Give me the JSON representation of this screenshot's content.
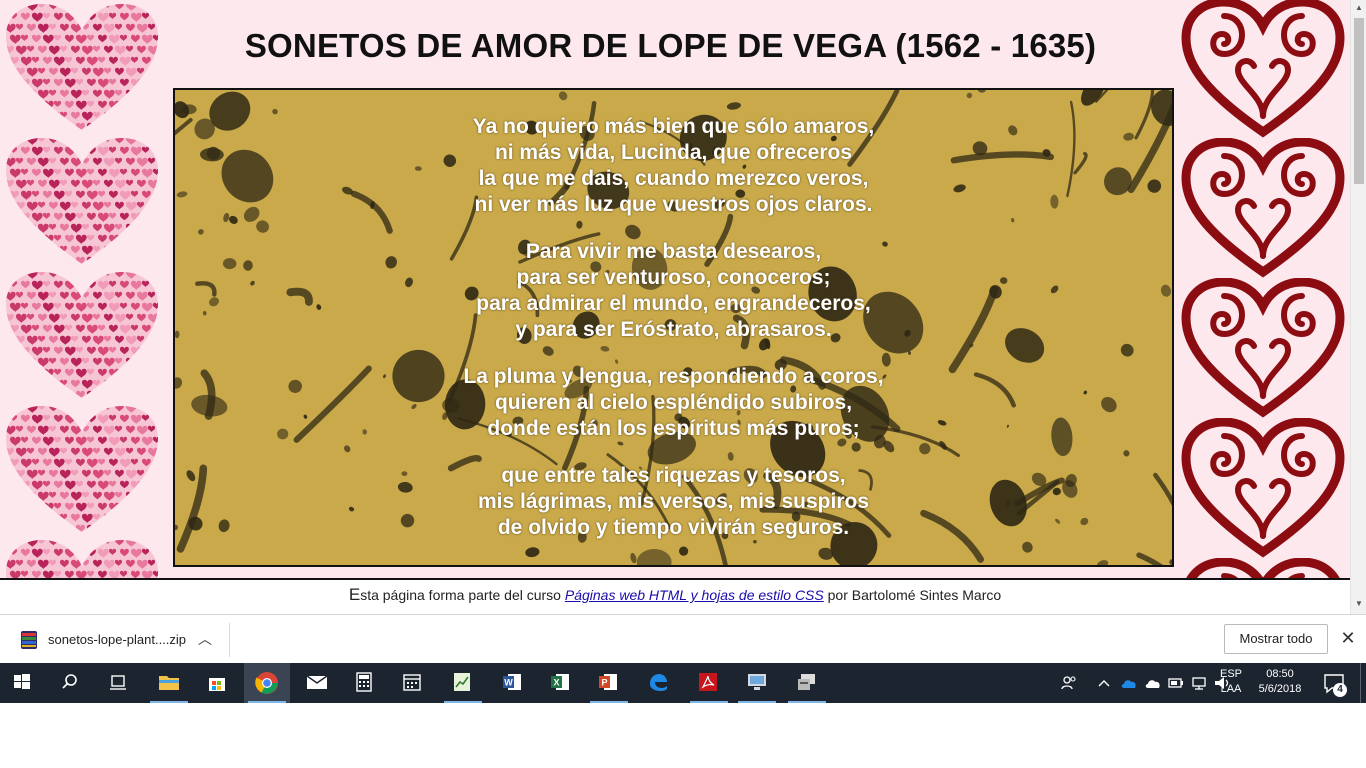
{
  "page": {
    "title": "SONETOS DE AMOR DE LOPE DE VEGA (1562 - 1635)",
    "poem": [
      [
        "Ya no quiero más bien que sólo amaros,",
        "ni más vida, Lucinda, que ofreceros",
        "la que me dais, cuando merezco veros,",
        "ni ver más luz que vuestros ojos claros."
      ],
      [
        "Para vivir me basta desearos,",
        "para ser venturoso, conoceros;",
        "para admirar el mundo, engrandeceros,",
        "y para ser Eróstrato, abrasaros."
      ],
      [
        "La pluma y lengua, respondiendo a coros,",
        "quieren al cielo espléndido subiros,",
        "donde están los espíritus más puros;"
      ],
      [
        "que entre tales riquezas y tesoros,",
        "mis lágrimas, mis versos, mis suspiros",
        "de olvido y tiempo vivirán seguros."
      ]
    ],
    "footer": {
      "cap": "E",
      "before": "sta página forma parte del curso ",
      "link": "Páginas web HTML y hojas de estilo CSS",
      "after": " por Bartolomé Sintes Marco"
    }
  },
  "download_bar": {
    "file_name": "sonetos-lope-plant....zip",
    "show_all": "Mostrar todo",
    "close_glyph": "✕",
    "caret_glyph": "︿"
  },
  "taskbar": {
    "apps": [
      "start",
      "search",
      "task-view",
      "file-explorer",
      "store",
      "chrome",
      "mail",
      "calculator",
      "calendar",
      "notepad-chart",
      "word",
      "excel",
      "powerpoint",
      "edge",
      "acrobat",
      "control-panel",
      "network-tool"
    ],
    "active_app": "chrome",
    "language": [
      "ESP",
      "LAA"
    ],
    "time": "08:50",
    "date": "5/6/2018",
    "notifications": "4"
  },
  "colors": {
    "page_bg": "#fde8ee",
    "poem_bg": "#c9a94a",
    "splatter": "#2f2814",
    "heart_left": "#d94a79",
    "heart_right": "#8b0d12",
    "taskbar": "#1c2430"
  },
  "icons": {
    "left_strip": "patterned-heart-icon",
    "right_strip": "swirl-heart-icon"
  }
}
